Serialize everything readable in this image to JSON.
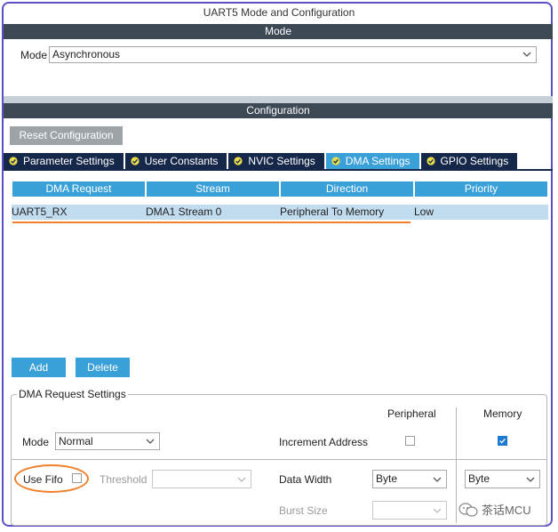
{
  "window": {
    "title": "UART5 Mode and Configuration"
  },
  "mode_section": {
    "bar_label": "Mode",
    "mode_label": "Mode",
    "mode_value": "Asynchronous"
  },
  "config_section": {
    "bar_label": "Configuration",
    "reset_button": "Reset Configuration",
    "tabs": [
      {
        "label": "Parameter Settings",
        "active": false
      },
      {
        "label": "User Constants",
        "active": false
      },
      {
        "label": "NVIC Settings",
        "active": false
      },
      {
        "label": "DMA Settings",
        "active": true
      },
      {
        "label": "GPIO Settings",
        "active": false
      }
    ]
  },
  "dma_table": {
    "headers": [
      "DMA Request",
      "Stream",
      "Direction",
      "Priority"
    ],
    "rows": [
      [
        "UART5_RX",
        "DMA1 Stream 0",
        "Peripheral To Memory",
        "Low"
      ]
    ]
  },
  "actions": {
    "add": "Add",
    "delete": "Delete"
  },
  "request_settings": {
    "title": "DMA Request Settings",
    "peripheral_header": "Peripheral",
    "memory_header": "Memory",
    "mode_label": "Mode",
    "mode_value": "Normal",
    "increment_address_label": "Increment Address",
    "peripheral_increment": false,
    "memory_increment": true,
    "use_fifo_label": "Use Fifo",
    "use_fifo": false,
    "threshold_label": "Threshold",
    "threshold_value": "",
    "data_width_label": "Data Width",
    "peripheral_data_width": "Byte",
    "memory_data_width": "Byte",
    "burst_size_label": "Burst Size",
    "peripheral_burst_size": "",
    "memory_burst_size": ""
  },
  "watermark": {
    "text": "茶话MCU"
  },
  "colors": {
    "accent": "#3aa0d8",
    "header_bar": "#3c4854",
    "tab_bg": "#16284a",
    "annotation": "#f0802a",
    "frame": "#5b4fc7",
    "checkbox_checked": "#1e7ad0"
  }
}
